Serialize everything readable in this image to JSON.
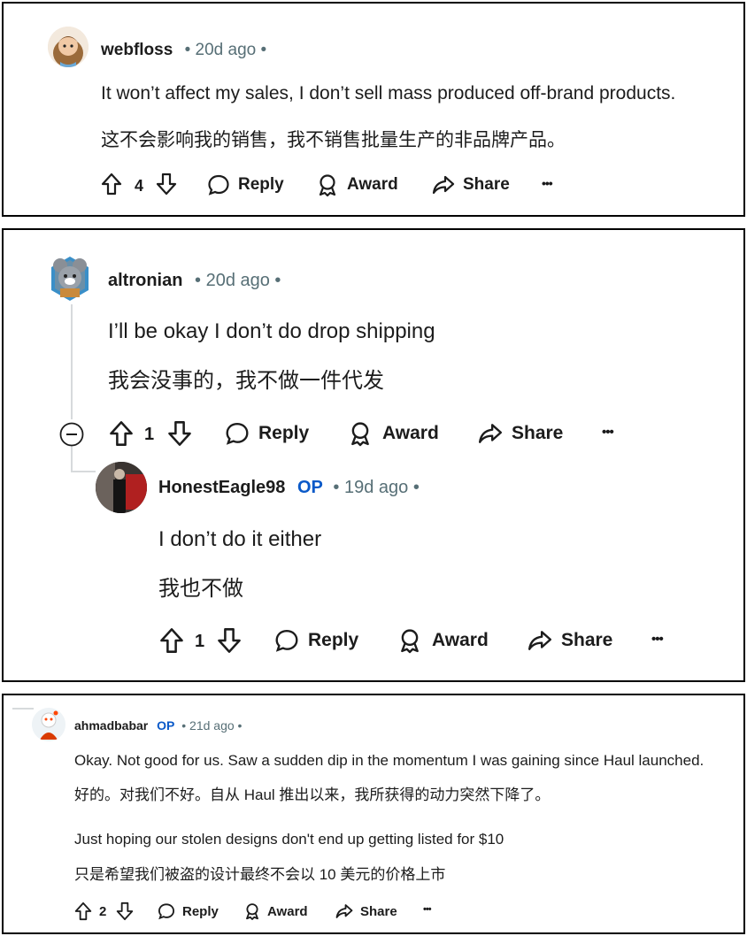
{
  "comments": [
    {
      "username": "webfloss",
      "time": "• 20d ago •",
      "lines": [
        "It won’t affect my sales, I don’t sell mass produced off-brand products.",
        "这不会影响我的销售，我不销售批量生产的非品牌产品。"
      ],
      "votes": "4",
      "reply": "Reply",
      "award": "Award",
      "share": "Share",
      "more": "•••"
    },
    {
      "username": "altronian",
      "time": "• 20d ago •",
      "lines": [
        "I’ll be okay I don’t do drop shipping",
        "我会没事的，我不做一件代发"
      ],
      "votes": "1",
      "reply": "Reply",
      "award": "Award",
      "share": "Share",
      "more": "•••"
    },
    {
      "username": "HonestEagle98",
      "op": "OP",
      "time": "• 19d ago •",
      "lines": [
        "I don’t do it either",
        "我也不做"
      ],
      "votes": "1",
      "reply": "Reply",
      "award": "Award",
      "share": "Share",
      "more": "•••"
    },
    {
      "username": "ahmadbabar",
      "op": "OP",
      "time": "• 21d ago •",
      "lines": [
        "Okay. Not good for us. Saw a sudden dip in the momentum I was gaining since Haul launched.",
        "好的。对我们不好。自从 Haul 推出以来，我所获得的动力突然下降了。",
        "Just hoping our stolen designs don't end up getting listed for $10",
        "只是希望我们被盗的设计最终不会以 10 美元的价格上市"
      ],
      "votes": "2",
      "reply": "Reply",
      "award": "Award",
      "share": "Share",
      "more": "•••"
    }
  ],
  "colors": {
    "text": "#1c1c1c",
    "meta": "#576f76",
    "op": "#0a59c8",
    "thread_line": "#d7dadc"
  }
}
